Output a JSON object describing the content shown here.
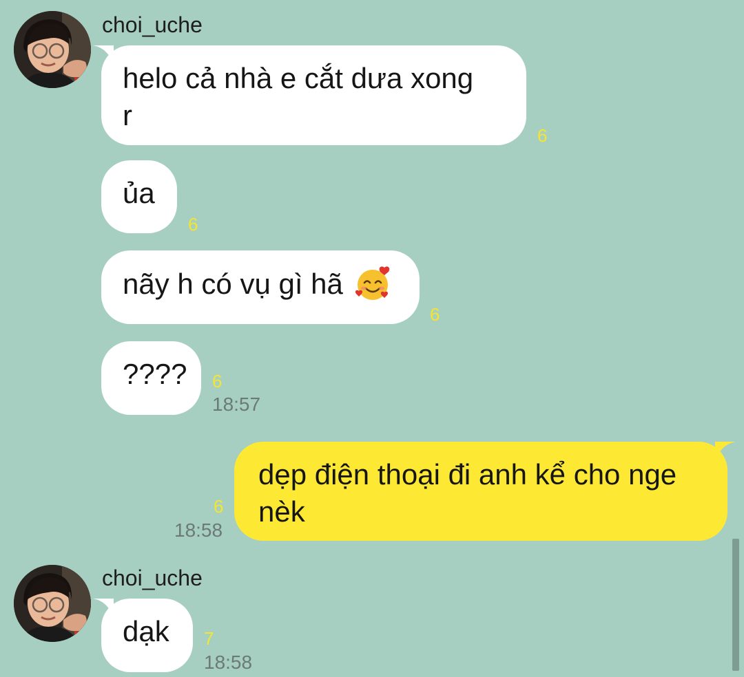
{
  "sender_name": "choi_uche",
  "colors": {
    "background": "#a6cfc2",
    "incoming_bubble": "#ffffff",
    "outgoing_bubble": "#fde934",
    "unread_count": "#f4e532",
    "timestamp": "#6b7a76"
  },
  "messages": [
    {
      "text": "helo cả nhà e cắt dưa xong\nr",
      "unread": "6",
      "time": ""
    },
    {
      "text": "ủa",
      "unread": "6",
      "time": ""
    },
    {
      "text": "nãy h có vụ gì hã",
      "emoji": "smiling-face-with-hearts-icon",
      "unread": "6",
      "time": ""
    },
    {
      "text": "????",
      "unread": "6",
      "time": "18:57"
    },
    {
      "text": "dẹp điện thoại đi anh kể cho nge\nnèk",
      "unread": "6",
      "time": "18:58"
    },
    {
      "text": "dạk",
      "unread": "7",
      "time": "18:58"
    }
  ]
}
